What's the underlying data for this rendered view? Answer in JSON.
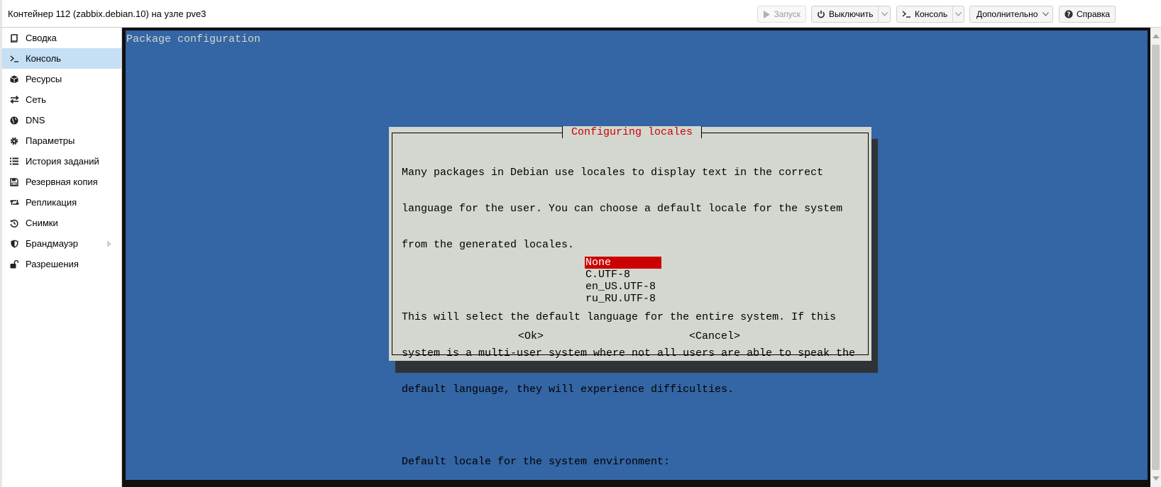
{
  "window": {
    "title": "Контейнер 112 (zabbix.debian.10) на узле pve3"
  },
  "toolbar": {
    "start_label": "Запуск",
    "shutdown_label": "Выключить",
    "console_label": "Консоль",
    "more_label": "Дополнительно",
    "help_label": "Справка"
  },
  "sidebar": {
    "items": [
      {
        "label": "Сводка",
        "icon": "book-icon"
      },
      {
        "label": "Консоль",
        "icon": "terminal-icon",
        "active": true
      },
      {
        "label": "Ресурсы",
        "icon": "cube-icon"
      },
      {
        "label": "Сеть",
        "icon": "exchange-icon"
      },
      {
        "label": "DNS",
        "icon": "globe-icon"
      },
      {
        "label": "Параметры",
        "icon": "gear-icon"
      },
      {
        "label": "История заданий",
        "icon": "list-icon"
      },
      {
        "label": "Резервная копия",
        "icon": "floppy-icon"
      },
      {
        "label": "Репликация",
        "icon": "retweet-icon"
      },
      {
        "label": "Снимки",
        "icon": "history-icon"
      },
      {
        "label": "Брандмауэр",
        "icon": "shield-icon"
      },
      {
        "label": "Разрешения",
        "icon": "unlock-icon"
      }
    ]
  },
  "terminal": {
    "header": "Package configuration",
    "dialog": {
      "title": "Configuring locales",
      "lines": [
        "Many packages in Debian use locales to display text in the correct",
        "language for the user. You can choose a default locale for the system",
        "from the generated locales.",
        "",
        "This will select the default language for the entire system. If this",
        "system is a multi-user system where not all users are able to speak the",
        "default language, they will experience difficulties.",
        "",
        "Default locale for the system environment:"
      ],
      "options": [
        "None",
        "C.UTF-8",
        "en_US.UTF-8",
        "ru_RU.UTF-8"
      ],
      "selected_option": "None",
      "ok_label": "<Ok>",
      "cancel_label": "<Cancel>"
    },
    "colors": {
      "background": "#3465a4",
      "dialog": "#d3d7cf",
      "accent": "#cc0000",
      "shadow": "#2e3436"
    }
  }
}
